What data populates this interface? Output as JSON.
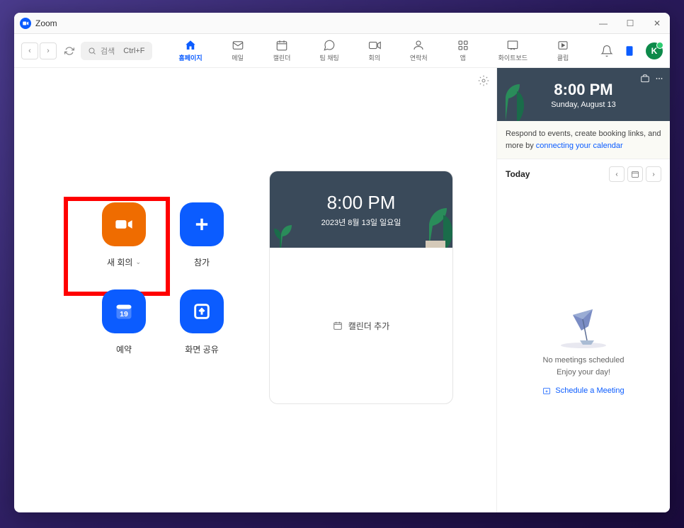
{
  "window": {
    "title": "Zoom"
  },
  "toolbar": {
    "search_label": "검색",
    "search_shortcut": "Ctrl+F",
    "nav": [
      {
        "label": "홈페이지",
        "active": true
      },
      {
        "label": "메일"
      },
      {
        "label": "캘린더"
      },
      {
        "label": "팀 채팅"
      },
      {
        "label": "회의"
      },
      {
        "label": "연락처"
      },
      {
        "label": "앱"
      },
      {
        "label": "화이트보드"
      },
      {
        "label": "클립"
      }
    ],
    "avatar_initial": "K"
  },
  "actions": {
    "new_meeting": "새 회의",
    "join": "참가",
    "schedule": "예약",
    "schedule_day": "19",
    "share": "화면 공유"
  },
  "calendar_card": {
    "time": "8:00 PM",
    "date": "2023년 8월 13일 일요일",
    "add_calendar": "캘린더 추가"
  },
  "sidebar": {
    "time": "8:00 PM",
    "date": "Sunday, August 13",
    "info_text": "Respond to events, create booking links, and more by ",
    "info_link": "connecting your calendar",
    "today": "Today",
    "empty_line1": "No meetings scheduled",
    "empty_line2": "Enjoy your day!",
    "schedule_meeting": "Schedule a Meeting"
  }
}
